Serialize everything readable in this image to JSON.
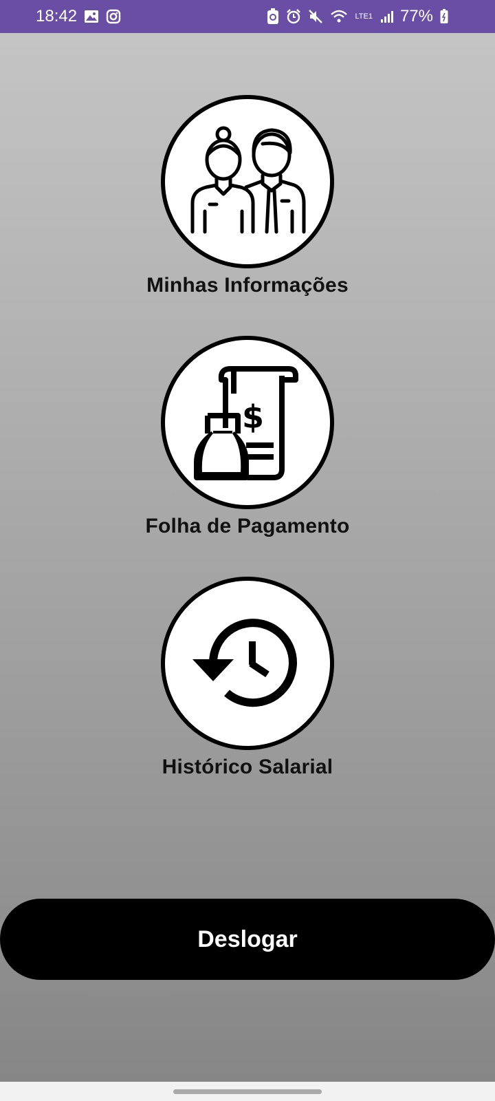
{
  "status_bar": {
    "time": "18:42",
    "battery": "77%",
    "network": "LTE1",
    "icons": [
      "image-icon",
      "instagram-icon",
      "recycle-icon",
      "alarm-icon",
      "mute-icon",
      "wifi-icon",
      "signal-icon",
      "battery-icon"
    ],
    "color": "#6a4ea6"
  },
  "menu": {
    "items": [
      {
        "label": "Minhas Informações",
        "icon": "people-icon"
      },
      {
        "label": "Folha de Pagamento",
        "icon": "payroll-icon"
      },
      {
        "label": "Histórico Salarial",
        "icon": "history-icon"
      }
    ]
  },
  "logout": {
    "label": "Deslogar"
  }
}
